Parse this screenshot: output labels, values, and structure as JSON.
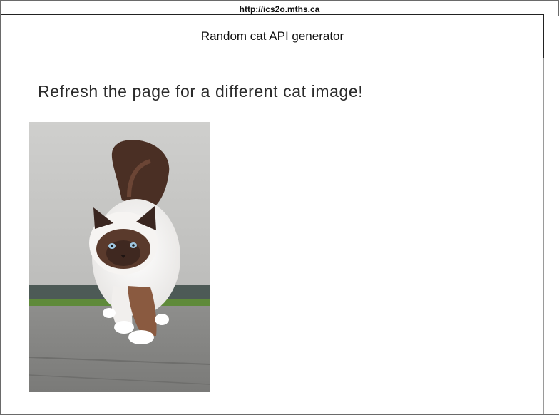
{
  "browser": {
    "url": "http://ics2o.mths.ca"
  },
  "header": {
    "title": "Random cat API generator"
  },
  "main": {
    "heading": "Refresh the page for a different cat image!",
    "image": {
      "alt": "Cat image"
    }
  },
  "icons": {
    "cat_image": "cat-photo-image"
  }
}
